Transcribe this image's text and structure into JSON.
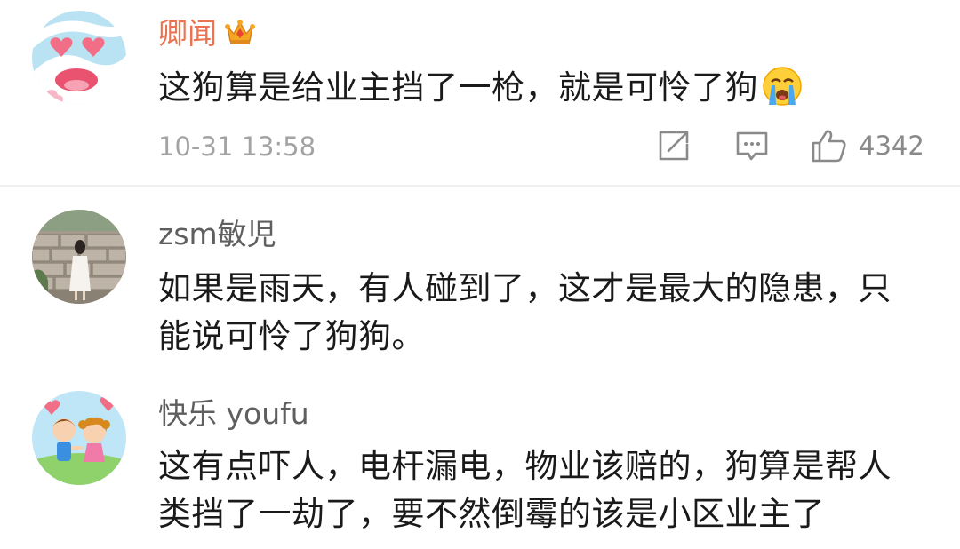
{
  "comments": [
    {
      "user": "卿闻",
      "text": "这狗算是给业主挡了一枪，就是可怜了狗",
      "time": "10-31 13:58",
      "likes": "4342",
      "badge_icon": "crown-icon",
      "emoji_icon": "crying-face-icon"
    },
    {
      "user": "zsm敏児",
      "text": "如果是雨天，有人碰到了，这才是最大的隐患，只能说可怜了狗狗。"
    },
    {
      "user": "快乐 youfu",
      "text": "这有点吓人，电杆漏电，物业该赔的，狗算是帮人类挡了一劫了，要不然倒霉的该是小区业主了"
    }
  ],
  "colors": {
    "vip_name": "#eb7350",
    "name": "#5f5f5f",
    "text": "#1a1a1a",
    "meta": "#a3a3a3",
    "divider": "#f0f0f0"
  },
  "icons": {
    "share": "share-icon",
    "reply": "comment-icon",
    "like": "thumbs-up-icon"
  }
}
